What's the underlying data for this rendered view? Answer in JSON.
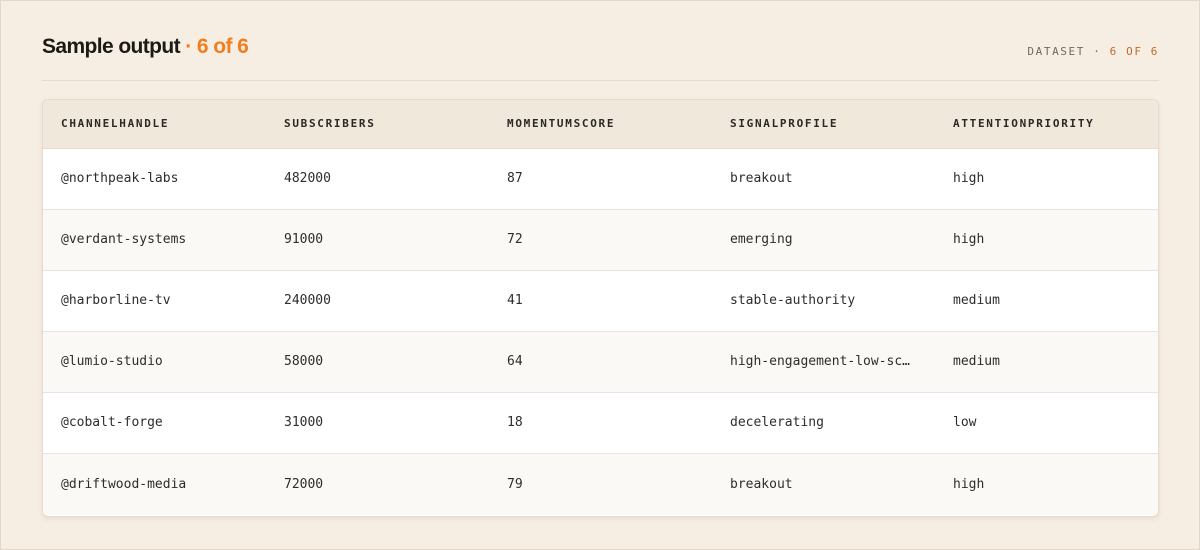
{
  "header": {
    "title": "Sample output",
    "title_sep": " · ",
    "title_count": "6 of 6",
    "dataset_label": "DATASET · ",
    "dataset_count": "6 OF 6"
  },
  "table": {
    "columns": [
      "CHANNELHANDLE",
      "SUBSCRIBERS",
      "MOMENTUMSCORE",
      "SIGNALPROFILE",
      "ATTENTIONPRIORITY"
    ],
    "rows": [
      [
        "@northpeak-labs",
        "482000",
        "87",
        "breakout",
        "high"
      ],
      [
        "@verdant-systems",
        "91000",
        "72",
        "emerging",
        "high"
      ],
      [
        "@harborline-tv",
        "240000",
        "41",
        "stable-authority",
        "medium"
      ],
      [
        "@lumio-studio",
        "58000",
        "64",
        "high-engagement-low-sc…",
        "medium"
      ],
      [
        "@cobalt-forge",
        "31000",
        "18",
        "decelerating",
        "low"
      ],
      [
        "@driftwood-media",
        "72000",
        "79",
        "breakout",
        "high"
      ]
    ]
  },
  "colors": {
    "accent": "#f07e1e",
    "background": "#f6eee3",
    "header_row": "#f1e8dc"
  }
}
